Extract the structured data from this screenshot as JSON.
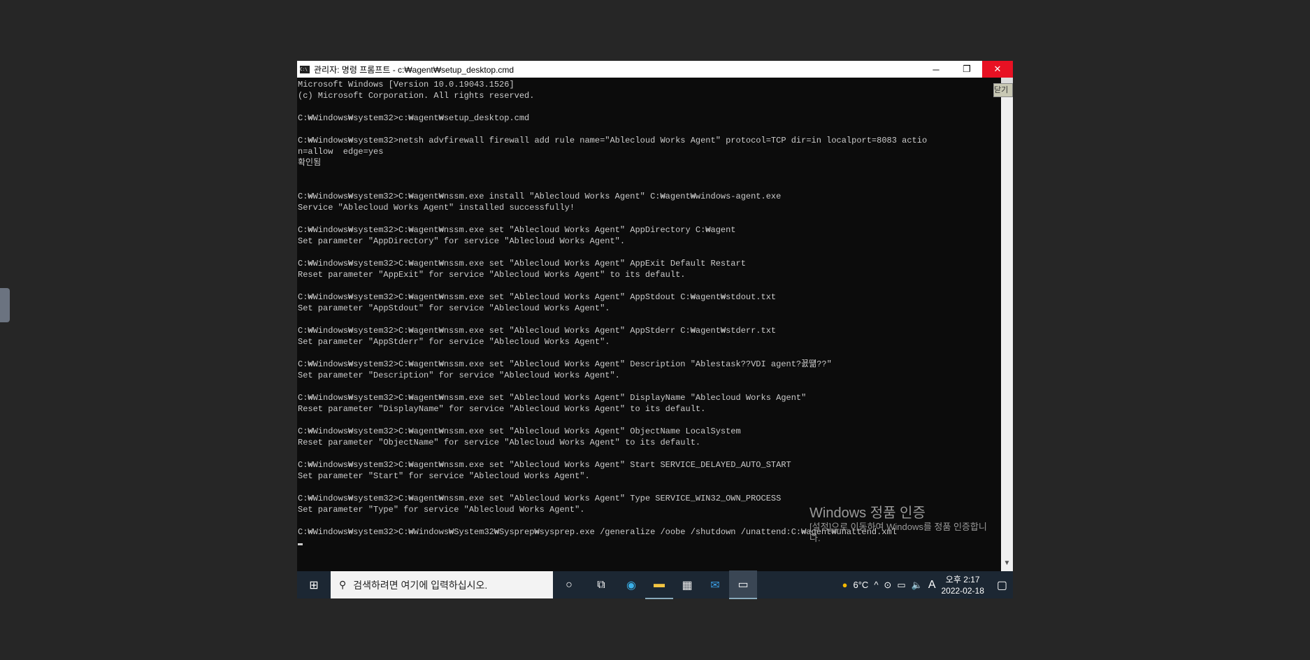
{
  "window": {
    "title": "관리자: 명령 프롬프트 - c:₩agent₩setup_desktop.cmd",
    "minimize": "─",
    "restore": "❐",
    "close": "✕",
    "tooltip": "닫기"
  },
  "terminal": {
    "lines": [
      "Microsoft Windows [Version 10.0.19043.1526]",
      "(c) Microsoft Corporation. All rights reserved.",
      "",
      "C:₩Windows₩system32>c:₩agent₩setup_desktop.cmd",
      "",
      "C:₩Windows₩system32>netsh advfirewall firewall add rule name=\"Ablecloud Works Agent\" protocol=TCP dir=in localport=8083 actio",
      "n=allow  edge=yes",
      "확인됨",
      "",
      "",
      "C:₩Windows₩system32>C:₩agent₩nssm.exe install \"Ablecloud Works Agent\" C:₩agent₩windows-agent.exe",
      "Service \"Ablecloud Works Agent\" installed successfully!",
      "",
      "C:₩Windows₩system32>C:₩agent₩nssm.exe set \"Ablecloud Works Agent\" AppDirectory C:₩agent",
      "Set parameter \"AppDirectory\" for service \"Ablecloud Works Agent\".",
      "",
      "C:₩Windows₩system32>C:₩agent₩nssm.exe set \"Ablecloud Works Agent\" AppExit Default Restart",
      "Reset parameter \"AppExit\" for service \"Ablecloud Works Agent\" to its default.",
      "",
      "C:₩Windows₩system32>C:₩agent₩nssm.exe set \"Ablecloud Works Agent\" AppStdout C:₩agent₩stdout.txt",
      "Set parameter \"AppStdout\" for service \"Ablecloud Works Agent\".",
      "",
      "C:₩Windows₩system32>C:₩agent₩nssm.exe set \"Ablecloud Works Agent\" AppStderr C:₩agent₩stderr.txt",
      "Set parameter \"AppStderr\" for service \"Ablecloud Works Agent\".",
      "",
      "C:₩Windows₩system32>C:₩agent₩nssm.exe set \"Ablecloud Works Agent\" Description \"Ablestask??VDI agent?꾨떎??\"",
      "Set parameter \"Description\" for service \"Ablecloud Works Agent\".",
      "",
      "C:₩Windows₩system32>C:₩agent₩nssm.exe set \"Ablecloud Works Agent\" DisplayName \"Ablecloud Works Agent\"",
      "Reset parameter \"DisplayName\" for service \"Ablecloud Works Agent\" to its default.",
      "",
      "C:₩Windows₩system32>C:₩agent₩nssm.exe set \"Ablecloud Works Agent\" ObjectName LocalSystem",
      "Reset parameter \"ObjectName\" for service \"Ablecloud Works Agent\" to its default.",
      "",
      "C:₩Windows₩system32>C:₩agent₩nssm.exe set \"Ablecloud Works Agent\" Start SERVICE_DELAYED_AUTO_START",
      "Set parameter \"Start\" for service \"Ablecloud Works Agent\".",
      "",
      "C:₩Windows₩system32>C:₩agent₩nssm.exe set \"Ablecloud Works Agent\" Type SERVICE_WIN32_OWN_PROCESS",
      "Set parameter \"Type\" for service \"Ablecloud Works Agent\".",
      "",
      "C:₩Windows₩system32>C:₩Windows₩System32₩Sysprep₩sysprep.exe /generalize /oobe /shutdown /unattend:C:₩agent₩unattend.xml"
    ]
  },
  "watermark": {
    "title": "Windows 정품 인증",
    "subtitle": "[설정]으로 이동하여 Windows를 정품 인증합니다."
  },
  "taskbar": {
    "search_placeholder": "검색하려면 여기에 입력하십시오.",
    "weather": "6°C",
    "ime": "A",
    "time": "오후 2:17",
    "date": "2022-02-18"
  }
}
